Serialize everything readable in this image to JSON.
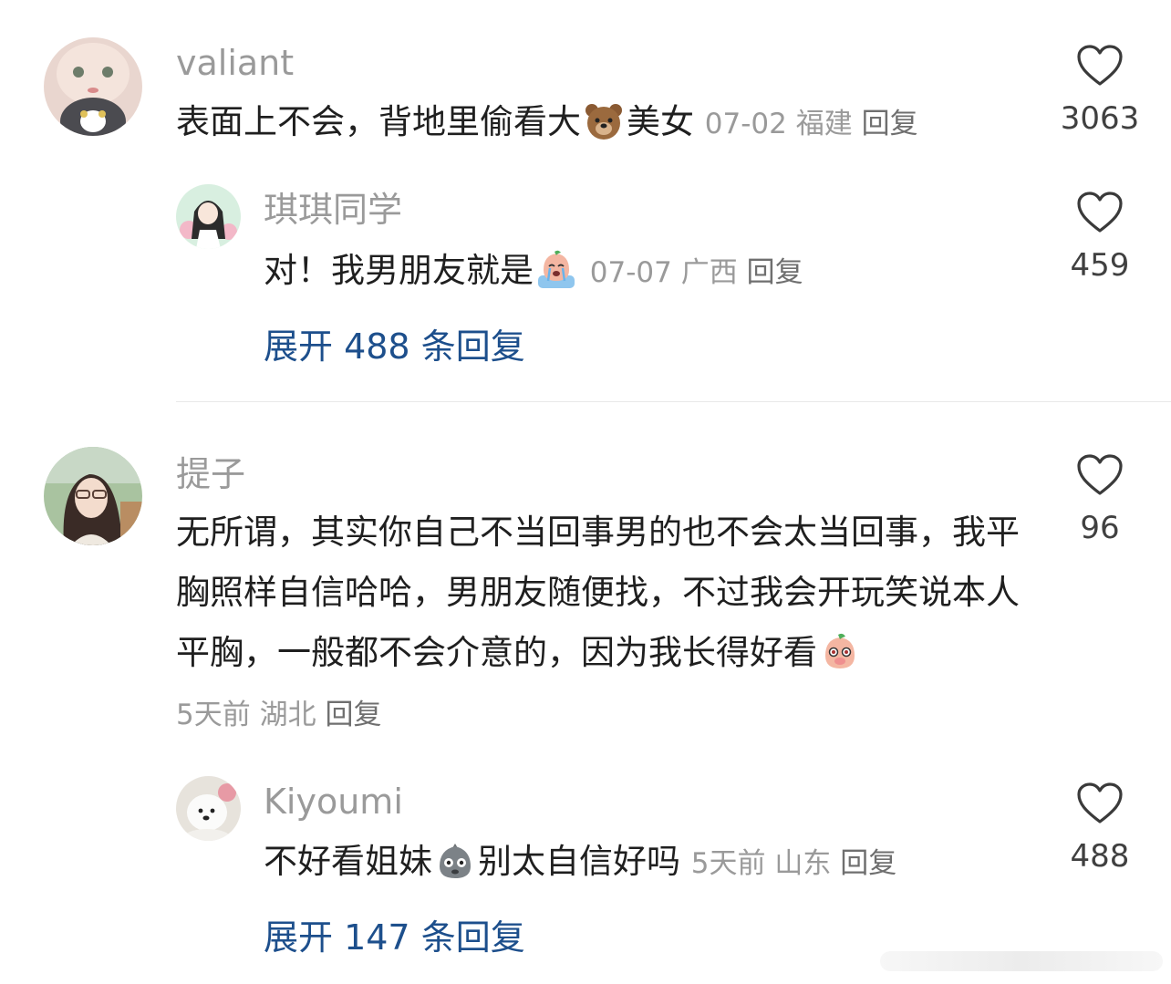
{
  "comments": [
    {
      "username": "valiant",
      "text_before": "表面上不会，背地里偷看大",
      "emoji": "bear-emoji",
      "text_after": "美女",
      "date": "07-02",
      "location": "福建",
      "reply_label": "回复",
      "likes": "3063",
      "replies": [
        {
          "username": "琪琪同学",
          "text_before": "对！我男朋友就是",
          "emoji": "crying-peach-emoji",
          "text_after": "",
          "date": "07-07",
          "location": "广西",
          "reply_label": "回复",
          "likes": "459"
        }
      ],
      "expand_label": "展开 488 条回复"
    },
    {
      "username": "提子",
      "text_before": "无所谓，其实你自己不当回事男的也不会太当回事，我平胸照样自信哈哈，男朋友随便找，不过我会开玩笑说本人平胸，一般都不会介意的，因为我长得好看",
      "emoji": "shy-peach-emoji",
      "text_after": "",
      "date": "5天前",
      "location": "湖北",
      "reply_label": "回复",
      "likes": "96",
      "replies": [
        {
          "username": "Kiyoumi",
          "text_before": "不好看姐妹",
          "emoji": "gray-blob-emoji",
          "text_after": "别太自信好吗",
          "date": "5天前",
          "location": "山东",
          "reply_label": "回复",
          "likes": "488"
        }
      ],
      "expand_label": "展开 147 条回复"
    }
  ],
  "colors": {
    "username": "#9a9a9a",
    "body_text": "#1f1f1f",
    "meta": "#9a9a9a",
    "expand_link": "#1d4f8c",
    "divider": "#e8e8e8"
  },
  "icons": {
    "like": "heart-outline-icon"
  }
}
